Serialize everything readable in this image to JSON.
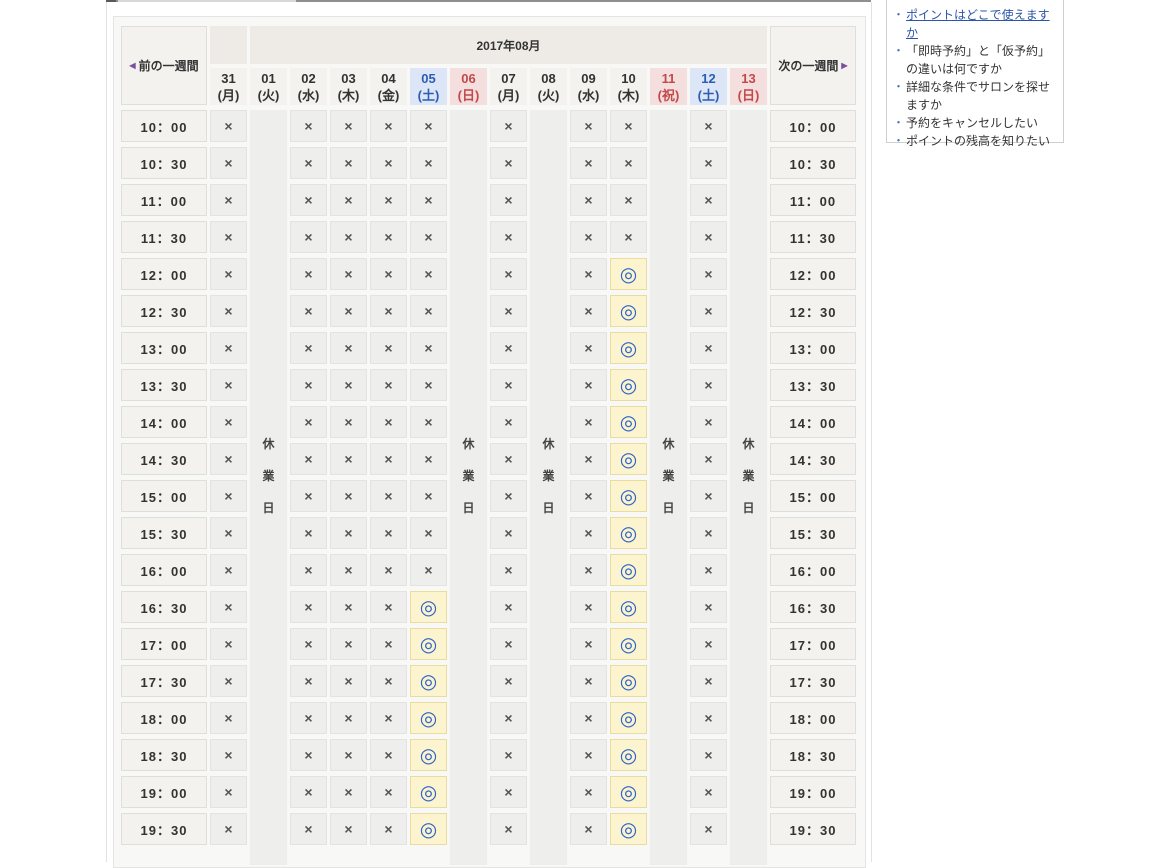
{
  "calendar": {
    "month_label": "2017年08月",
    "prev_week": "前の一週間",
    "next_week": "次の一週間",
    "prev_arrow": "◀",
    "next_arrow": "▶",
    "days": [
      {
        "num": "31",
        "dow": "(月)",
        "type": "weekday",
        "closed": false
      },
      {
        "num": "01",
        "dow": "(火)",
        "type": "weekday",
        "closed": true
      },
      {
        "num": "02",
        "dow": "(水)",
        "type": "weekday",
        "closed": false
      },
      {
        "num": "03",
        "dow": "(木)",
        "type": "weekday",
        "closed": false
      },
      {
        "num": "04",
        "dow": "(金)",
        "type": "weekday",
        "closed": false
      },
      {
        "num": "05",
        "dow": "(土)",
        "type": "sat",
        "closed": false
      },
      {
        "num": "06",
        "dow": "(日)",
        "type": "sun",
        "closed": true
      },
      {
        "num": "07",
        "dow": "(月)",
        "type": "weekday",
        "closed": false
      },
      {
        "num": "08",
        "dow": "(火)",
        "type": "weekday",
        "closed": true
      },
      {
        "num": "09",
        "dow": "(水)",
        "type": "weekday",
        "closed": false
      },
      {
        "num": "10",
        "dow": "(木)",
        "type": "weekday",
        "closed": false
      },
      {
        "num": "11",
        "dow": "(祝)",
        "type": "sun",
        "closed": true
      },
      {
        "num": "12",
        "dow": "(土)",
        "type": "sat",
        "closed": false
      },
      {
        "num": "13",
        "dow": "(日)",
        "type": "sun",
        "closed": true
      }
    ],
    "closed_label": [
      "休",
      "業",
      "日"
    ],
    "unavailable_mark": "×",
    "available_mark": "◎",
    "times": [
      "10：00",
      "10：30",
      "11：00",
      "11：30",
      "12：00",
      "12：30",
      "13：00",
      "13：30",
      "14：00",
      "14：30",
      "15：00",
      "15：30",
      "16：00",
      "16：30",
      "17：00",
      "17：30",
      "18：00",
      "18：30",
      "19：00",
      "19：30"
    ],
    "availability": {
      "05": [
        "16：30",
        "17：00",
        "17：30",
        "18：00",
        "18：30",
        "19：00",
        "19：30"
      ],
      "10": [
        "12：00",
        "12：30",
        "13：00",
        "13：30",
        "14：00",
        "14：30",
        "15：00",
        "15：30",
        "16：00",
        "16：30",
        "17：00",
        "17：30",
        "18：00",
        "18：30",
        "19：00",
        "19：30"
      ]
    }
  },
  "faq": {
    "items": [
      {
        "text": "ポイントはどこで使えますか",
        "link": true
      },
      {
        "text": "「即時予約」と「仮予約」の違いは何ですか",
        "link": false
      },
      {
        "text": "詳細な条件でサロンを探せますか",
        "link": false
      },
      {
        "text": "予約をキャンセルしたい",
        "link": false
      },
      {
        "text": "ポイントの残高を知りたい",
        "link": false
      }
    ]
  },
  "colors": {
    "accent_link": "#2b55a8",
    "saturday": "#2c5db2",
    "sunday_holiday": "#c04a4a",
    "available_bg": "#fbf4cf"
  }
}
